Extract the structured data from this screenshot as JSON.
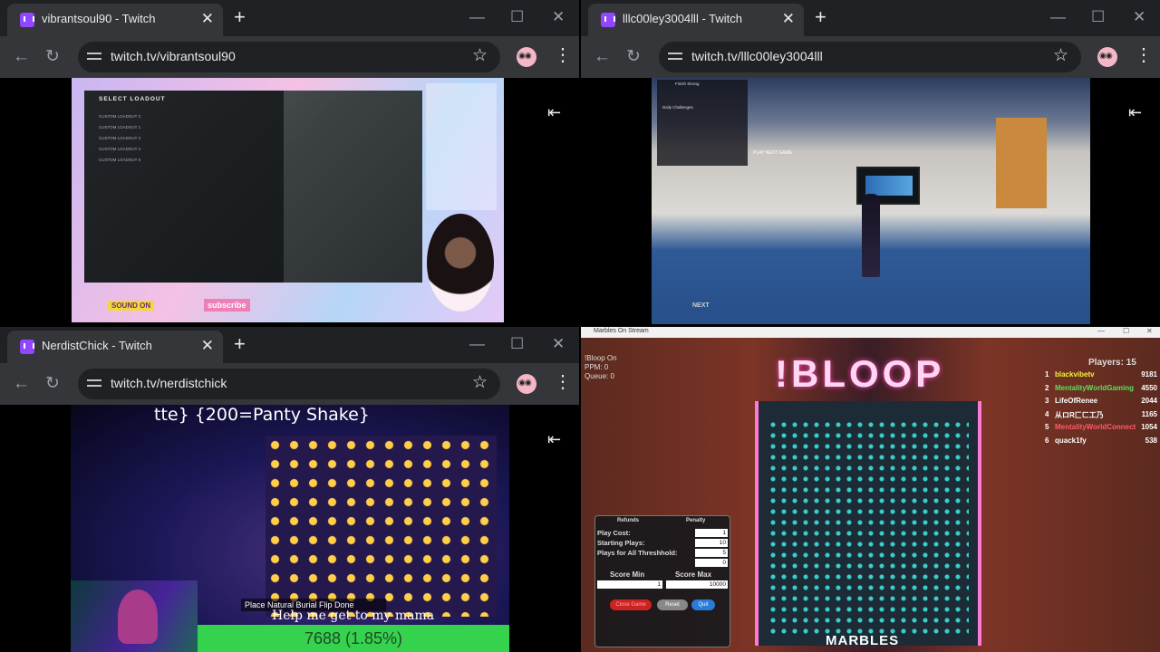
{
  "windows": [
    {
      "tab_title": "vibrantsoul90 - Twitch",
      "url": "twitch.tv/vibrantsoul90"
    },
    {
      "tab_title": "lllc00ley3004lll - Twitch",
      "url": "twitch.tv/lllc00ley3004lll"
    },
    {
      "tab_title": "NerdistChick - Twitch",
      "url": "twitch.tv/nerdistchick"
    }
  ],
  "controls": {
    "close_tab": "✕",
    "new_tab": "+",
    "minimize": "—",
    "maximize": "☐",
    "close_window": "✕",
    "back": "←",
    "reload": "↻",
    "star": "☆",
    "menu": "⋮",
    "theater": "⇤"
  },
  "stream1": {
    "menu_title": "SELECT LOADOUT",
    "menu_items": [
      "CUSTOM LOADOUT 2",
      "CUSTOM LOADOUT 1",
      "CUSTOM LOADOUT 3",
      "CUSTOM LOADOUT 4",
      "CUSTOM LOADOUT 5"
    ],
    "sound_on": "SOUND ON",
    "subscribe": "subscribe"
  },
  "stream2": {
    "panel_lines": [
      "Finish Strong",
      "Daily Challenges"
    ],
    "play_next": "PLAY NEXT GAME",
    "next": "NEXT"
  },
  "stream3": {
    "banner": "tte} {200=Panty Shake}",
    "hud": "Place Natural Burial   Flip   Done",
    "help_text": "Help me get to my mama",
    "progress_text": "7688 (1.85%)",
    "progress_fraction": 0.0185
  },
  "marbles": {
    "window_title": "Marbles On Stream",
    "board_title": "!BLOOP",
    "stats": [
      "!Bloop On",
      "PPM:   0",
      "Queue:  0"
    ],
    "players_label": "Players: 15",
    "leaderboard": [
      {
        "rank": "1",
        "name": "blackvibetv",
        "score": "9181",
        "color": "#f6f33a"
      },
      {
        "rank": "2",
        "name": "MentalityWorldGaming",
        "score": "4550",
        "color": "#58e35a"
      },
      {
        "rank": "3",
        "name": "LifeOfRenee",
        "score": "2044",
        "color": "#ffffff"
      },
      {
        "rank": "4",
        "name": "从ロR匚ㄈ工乃",
        "score": "1165",
        "color": "#ffffff"
      },
      {
        "rank": "5",
        "name": "MentalityWorldConnect",
        "score": "1054",
        "color": "#ff5a6a"
      },
      {
        "rank": "6",
        "name": "quack1fy",
        "score": "538",
        "color": "#ffffff"
      }
    ],
    "settings": {
      "refunds": "Refunds",
      "penalty": "Penalty",
      "rows": [
        {
          "label": "Play Cost:",
          "value": "1"
        },
        {
          "label": "Starting Plays:",
          "value": "10"
        },
        {
          "label": "Plays for All Threshhold:",
          "value": "5"
        },
        {
          "label": "",
          "value": "0"
        }
      ],
      "score_min_label": "Score Min",
      "score_max_label": "Score Max",
      "score_min": "1",
      "score_max": "10000",
      "buttons": [
        "Close Game",
        "Reset",
        "Quit"
      ]
    },
    "logo": "MARBLES"
  }
}
